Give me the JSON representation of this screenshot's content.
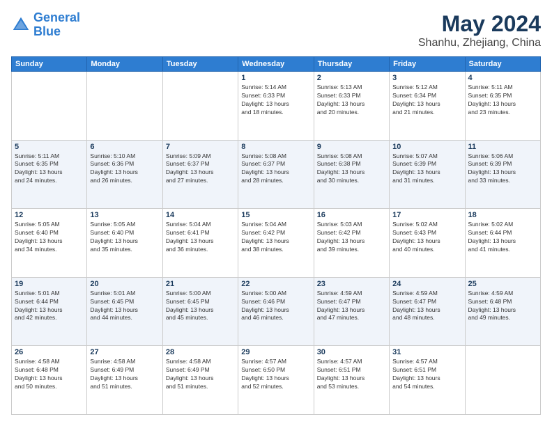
{
  "logo": {
    "line1": "General",
    "line2": "Blue"
  },
  "title": "May 2024",
  "subtitle": "Shanhu, Zhejiang, China",
  "days_of_week": [
    "Sunday",
    "Monday",
    "Tuesday",
    "Wednesday",
    "Thursday",
    "Friday",
    "Saturday"
  ],
  "weeks": [
    [
      {
        "day": "",
        "info": ""
      },
      {
        "day": "",
        "info": ""
      },
      {
        "day": "",
        "info": ""
      },
      {
        "day": "1",
        "info": "Sunrise: 5:14 AM\nSunset: 6:33 PM\nDaylight: 13 hours\nand 18 minutes."
      },
      {
        "day": "2",
        "info": "Sunrise: 5:13 AM\nSunset: 6:33 PM\nDaylight: 13 hours\nand 20 minutes."
      },
      {
        "day": "3",
        "info": "Sunrise: 5:12 AM\nSunset: 6:34 PM\nDaylight: 13 hours\nand 21 minutes."
      },
      {
        "day": "4",
        "info": "Sunrise: 5:11 AM\nSunset: 6:35 PM\nDaylight: 13 hours\nand 23 minutes."
      }
    ],
    [
      {
        "day": "5",
        "info": "Sunrise: 5:11 AM\nSunset: 6:35 PM\nDaylight: 13 hours\nand 24 minutes."
      },
      {
        "day": "6",
        "info": "Sunrise: 5:10 AM\nSunset: 6:36 PM\nDaylight: 13 hours\nand 26 minutes."
      },
      {
        "day": "7",
        "info": "Sunrise: 5:09 AM\nSunset: 6:37 PM\nDaylight: 13 hours\nand 27 minutes."
      },
      {
        "day": "8",
        "info": "Sunrise: 5:08 AM\nSunset: 6:37 PM\nDaylight: 13 hours\nand 28 minutes."
      },
      {
        "day": "9",
        "info": "Sunrise: 5:08 AM\nSunset: 6:38 PM\nDaylight: 13 hours\nand 30 minutes."
      },
      {
        "day": "10",
        "info": "Sunrise: 5:07 AM\nSunset: 6:39 PM\nDaylight: 13 hours\nand 31 minutes."
      },
      {
        "day": "11",
        "info": "Sunrise: 5:06 AM\nSunset: 6:39 PM\nDaylight: 13 hours\nand 33 minutes."
      }
    ],
    [
      {
        "day": "12",
        "info": "Sunrise: 5:05 AM\nSunset: 6:40 PM\nDaylight: 13 hours\nand 34 minutes."
      },
      {
        "day": "13",
        "info": "Sunrise: 5:05 AM\nSunset: 6:40 PM\nDaylight: 13 hours\nand 35 minutes."
      },
      {
        "day": "14",
        "info": "Sunrise: 5:04 AM\nSunset: 6:41 PM\nDaylight: 13 hours\nand 36 minutes."
      },
      {
        "day": "15",
        "info": "Sunrise: 5:04 AM\nSunset: 6:42 PM\nDaylight: 13 hours\nand 38 minutes."
      },
      {
        "day": "16",
        "info": "Sunrise: 5:03 AM\nSunset: 6:42 PM\nDaylight: 13 hours\nand 39 minutes."
      },
      {
        "day": "17",
        "info": "Sunrise: 5:02 AM\nSunset: 6:43 PM\nDaylight: 13 hours\nand 40 minutes."
      },
      {
        "day": "18",
        "info": "Sunrise: 5:02 AM\nSunset: 6:44 PM\nDaylight: 13 hours\nand 41 minutes."
      }
    ],
    [
      {
        "day": "19",
        "info": "Sunrise: 5:01 AM\nSunset: 6:44 PM\nDaylight: 13 hours\nand 42 minutes."
      },
      {
        "day": "20",
        "info": "Sunrise: 5:01 AM\nSunset: 6:45 PM\nDaylight: 13 hours\nand 44 minutes."
      },
      {
        "day": "21",
        "info": "Sunrise: 5:00 AM\nSunset: 6:45 PM\nDaylight: 13 hours\nand 45 minutes."
      },
      {
        "day": "22",
        "info": "Sunrise: 5:00 AM\nSunset: 6:46 PM\nDaylight: 13 hours\nand 46 minutes."
      },
      {
        "day": "23",
        "info": "Sunrise: 4:59 AM\nSunset: 6:47 PM\nDaylight: 13 hours\nand 47 minutes."
      },
      {
        "day": "24",
        "info": "Sunrise: 4:59 AM\nSunset: 6:47 PM\nDaylight: 13 hours\nand 48 minutes."
      },
      {
        "day": "25",
        "info": "Sunrise: 4:59 AM\nSunset: 6:48 PM\nDaylight: 13 hours\nand 49 minutes."
      }
    ],
    [
      {
        "day": "26",
        "info": "Sunrise: 4:58 AM\nSunset: 6:48 PM\nDaylight: 13 hours\nand 50 minutes."
      },
      {
        "day": "27",
        "info": "Sunrise: 4:58 AM\nSunset: 6:49 PM\nDaylight: 13 hours\nand 51 minutes."
      },
      {
        "day": "28",
        "info": "Sunrise: 4:58 AM\nSunset: 6:49 PM\nDaylight: 13 hours\nand 51 minutes."
      },
      {
        "day": "29",
        "info": "Sunrise: 4:57 AM\nSunset: 6:50 PM\nDaylight: 13 hours\nand 52 minutes."
      },
      {
        "day": "30",
        "info": "Sunrise: 4:57 AM\nSunset: 6:51 PM\nDaylight: 13 hours\nand 53 minutes."
      },
      {
        "day": "31",
        "info": "Sunrise: 4:57 AM\nSunset: 6:51 PM\nDaylight: 13 hours\nand 54 minutes."
      },
      {
        "day": "",
        "info": ""
      }
    ]
  ]
}
